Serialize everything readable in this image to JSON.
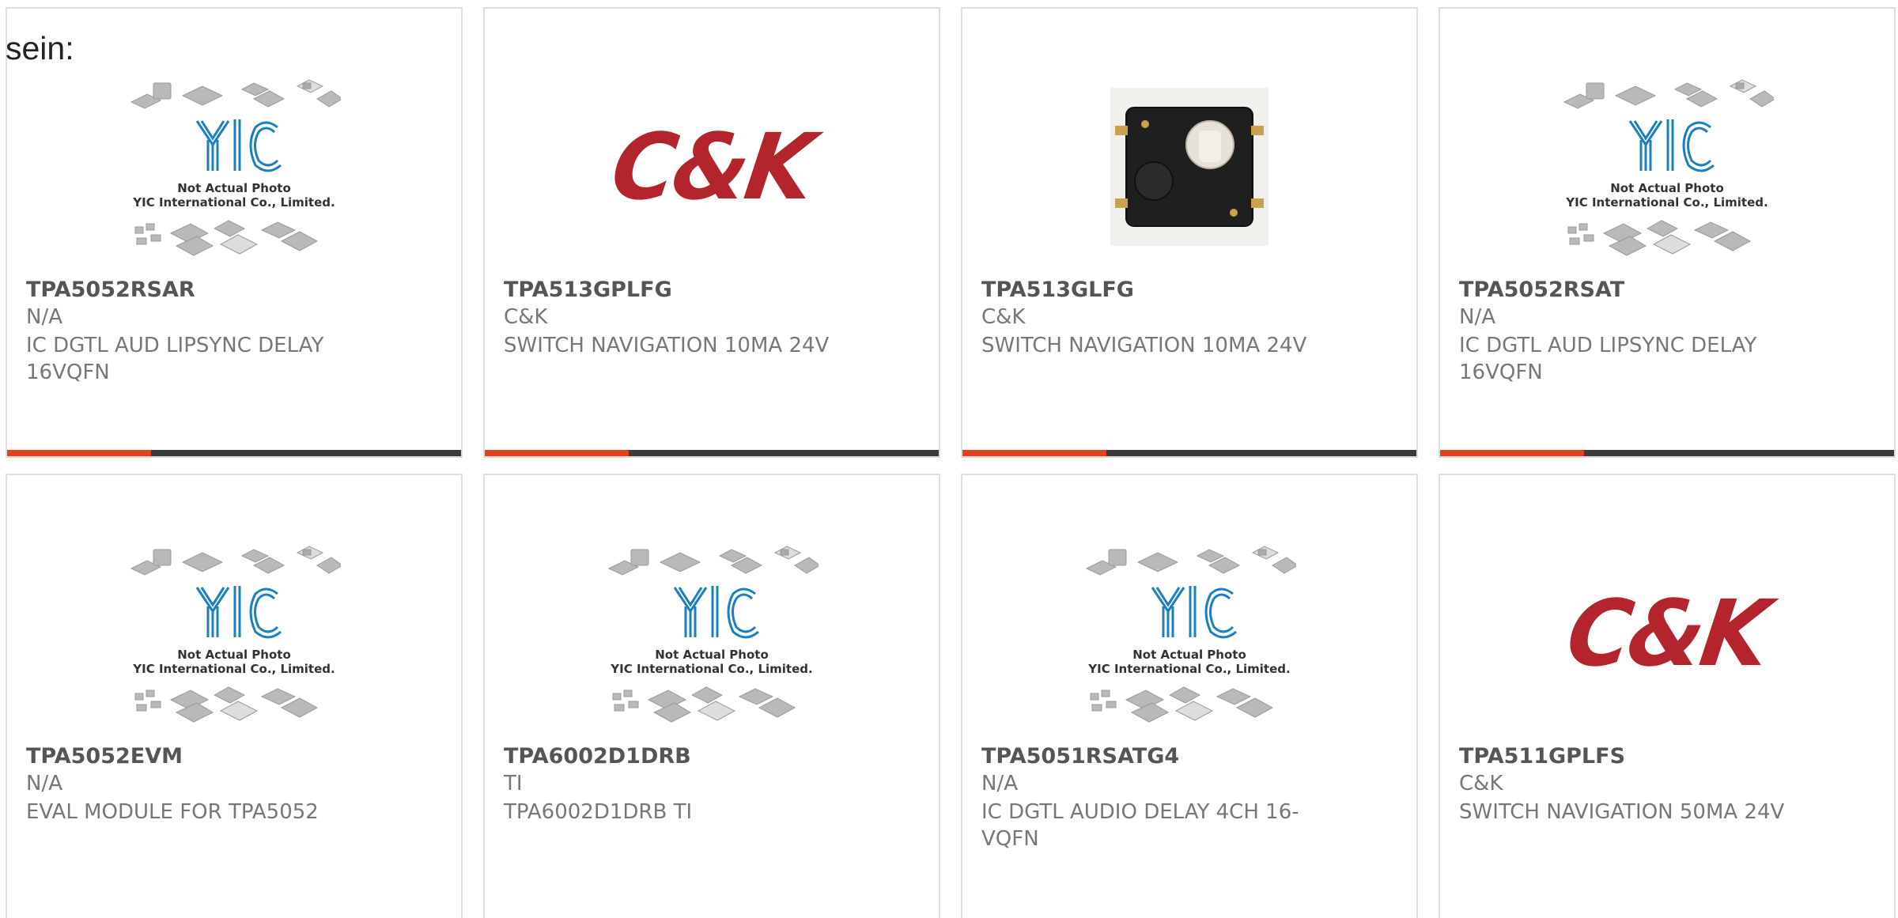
{
  "intro_text": "sein:",
  "colors": {
    "card_border": "#dedede",
    "bar_dark": "#3b3b3b",
    "bar_accent": "#e8401c",
    "ck_red": "#b3242c",
    "yic_blue": "#1a7fc1"
  },
  "placeholder": {
    "brand": "YIC",
    "line1": "Not Actual Photo",
    "line2": "YIC International Co., Limited."
  },
  "ck_brand": "C&K",
  "products": [
    {
      "part": "TPA5052RSAR",
      "mfr": "N/A",
      "desc": "IC DGTL AUD LIPSYNC DELAY 16VQFN",
      "image": "yic-placeholder",
      "bar": true
    },
    {
      "part": "TPA513GPLFG",
      "mfr": "C&K",
      "desc": "SWITCH NAVIGATION 10MA 24V",
      "image": "ck-logo",
      "bar": true
    },
    {
      "part": "TPA513GLFG",
      "mfr": "C&K",
      "desc": "SWITCH NAVIGATION 10MA 24V",
      "image": "switch-photo",
      "bar": true
    },
    {
      "part": "TPA5052RSAT",
      "mfr": "N/A",
      "desc": "IC DGTL AUD LIPSYNC DELAY 16VQFN",
      "image": "yic-placeholder",
      "bar": true
    },
    {
      "part": "TPA5052EVM",
      "mfr": "N/A",
      "desc": "EVAL MODULE FOR TPA5052",
      "image": "yic-placeholder",
      "bar": false
    },
    {
      "part": "TPA6002D1DRB",
      "mfr": "TI",
      "desc": "TPA6002D1DRB TI",
      "image": "yic-placeholder",
      "bar": false
    },
    {
      "part": "TPA5051RSATG4",
      "mfr": "N/A",
      "desc": "IC DGTL AUDIO DELAY 4CH 16-VQFN",
      "image": "yic-placeholder",
      "bar": false
    },
    {
      "part": "TPA511GPLFS",
      "mfr": "C&K",
      "desc": "SWITCH NAVIGATION 50MA 24V",
      "image": "ck-logo",
      "bar": false
    }
  ]
}
